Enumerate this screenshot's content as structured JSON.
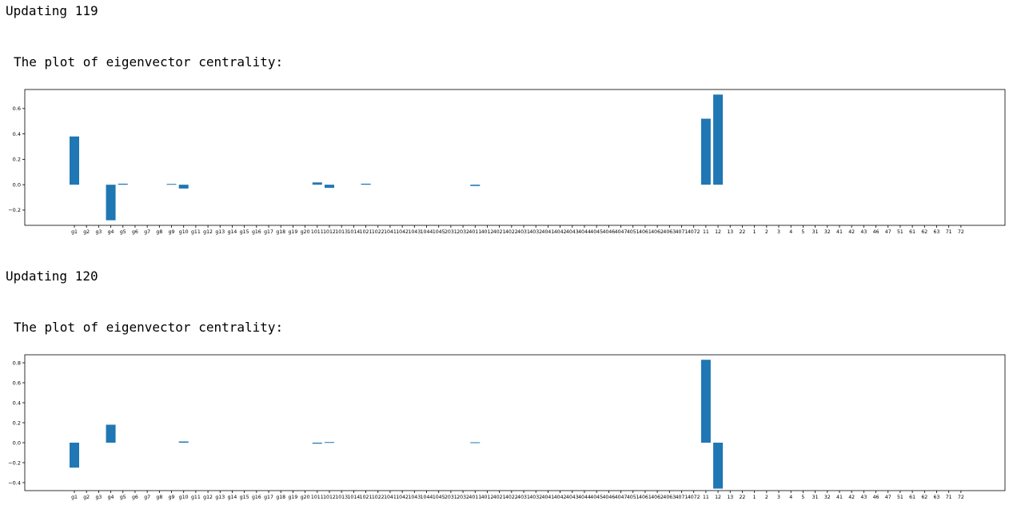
{
  "cells": [
    {
      "heading": "Updating 119",
      "caption": "The plot of eigenvector centrality:"
    },
    {
      "heading": "Updating 120",
      "caption": "The plot of eigenvector centrality:"
    }
  ],
  "chart_data": [
    {
      "type": "bar",
      "color": "#1f77b4",
      "ylim": [
        -0.32,
        0.75
      ],
      "yticks": [
        -0.2,
        0.0,
        0.2,
        0.4,
        0.6
      ],
      "ytick_labels": [
        "−0.2",
        "0.0",
        "0.2",
        "0.4",
        "0.6"
      ],
      "categories": [
        "g1",
        "g2",
        "g3",
        "g4",
        "g5",
        "g6",
        "g7",
        "g8",
        "g9",
        "g10",
        "g11",
        "g12",
        "g13",
        "g14",
        "g15",
        "g16",
        "g17",
        "g18",
        "g19",
        "g20",
        "1011",
        "1012",
        "1013",
        "1014",
        "1021",
        "1022",
        "1041",
        "1042",
        "1043",
        "1044",
        "1045",
        "2031",
        "2032",
        "4011",
        "4012",
        "4021",
        "4022",
        "4031",
        "4032",
        "4041",
        "4042",
        "4043",
        "4044",
        "4045",
        "4046",
        "4047",
        "4051",
        "4061",
        "4062",
        "4063",
        "4071",
        "4072",
        "11",
        "12",
        "13",
        "22",
        "1",
        "2",
        "3",
        "4",
        "5",
        "31",
        "32",
        "41",
        "42",
        "43",
        "46",
        "47",
        "51",
        "61",
        "62",
        "63",
        "71",
        "72"
      ],
      "values": [
        0.38,
        0,
        0,
        -0.28,
        0.008,
        0,
        0,
        0,
        0.006,
        -0.03,
        0,
        0,
        0,
        0,
        0,
        0,
        0,
        0,
        0,
        0,
        0.018,
        -0.025,
        0,
        0,
        0.008,
        0,
        0,
        0,
        0,
        0,
        0,
        0,
        0,
        -0.01,
        0,
        0,
        0,
        0,
        0,
        0,
        0,
        0,
        0,
        0,
        0,
        0,
        0,
        0,
        0,
        0,
        0,
        0,
        0.52,
        0.71,
        0,
        0,
        0,
        0,
        0,
        0,
        0,
        0,
        0,
        0,
        0,
        0,
        0,
        0,
        0,
        0,
        0,
        0,
        0,
        0
      ]
    },
    {
      "type": "bar",
      "color": "#1f77b4",
      "ylim": [
        -0.48,
        0.88
      ],
      "yticks": [
        -0.4,
        -0.2,
        0.0,
        0.2,
        0.4,
        0.6,
        0.8
      ],
      "ytick_labels": [
        "−0.4",
        "−0.2",
        "0.0",
        "0.2",
        "0.4",
        "0.6",
        "0.8"
      ],
      "categories": [
        "g1",
        "g2",
        "g3",
        "g4",
        "g5",
        "g6",
        "g7",
        "g8",
        "g9",
        "g10",
        "g11",
        "g12",
        "g13",
        "g14",
        "g15",
        "g16",
        "g17",
        "g18",
        "g19",
        "g20",
        "1011",
        "1012",
        "1013",
        "1014",
        "1021",
        "1022",
        "1041",
        "1042",
        "1043",
        "1044",
        "1045",
        "2031",
        "2032",
        "4011",
        "4012",
        "4021",
        "4022",
        "4031",
        "4032",
        "4041",
        "4042",
        "4043",
        "4044",
        "4045",
        "4046",
        "4047",
        "4051",
        "4061",
        "4062",
        "4063",
        "4071",
        "4072",
        "11",
        "12",
        "13",
        "22",
        "1",
        "2",
        "3",
        "4",
        "5",
        "31",
        "32",
        "41",
        "42",
        "43",
        "46",
        "47",
        "51",
        "61",
        "62",
        "63",
        "71",
        "72"
      ],
      "values": [
        -0.25,
        0,
        0,
        0.18,
        0,
        0,
        0,
        0,
        0,
        0.012,
        0,
        0,
        0,
        0,
        0,
        0,
        0,
        0,
        0,
        0,
        -0.01,
        0.006,
        0,
        0,
        0,
        0,
        0,
        0,
        0,
        0,
        0,
        0,
        0,
        0.004,
        0,
        0,
        0,
        0,
        0,
        0,
        0,
        0,
        0,
        0,
        0,
        0,
        0,
        0,
        0,
        0,
        0,
        0,
        0.83,
        -0.46,
        0,
        0,
        0,
        0,
        0,
        0,
        0,
        0,
        0,
        0,
        0,
        0,
        0,
        0,
        0,
        0,
        0,
        0,
        0,
        0
      ]
    }
  ]
}
